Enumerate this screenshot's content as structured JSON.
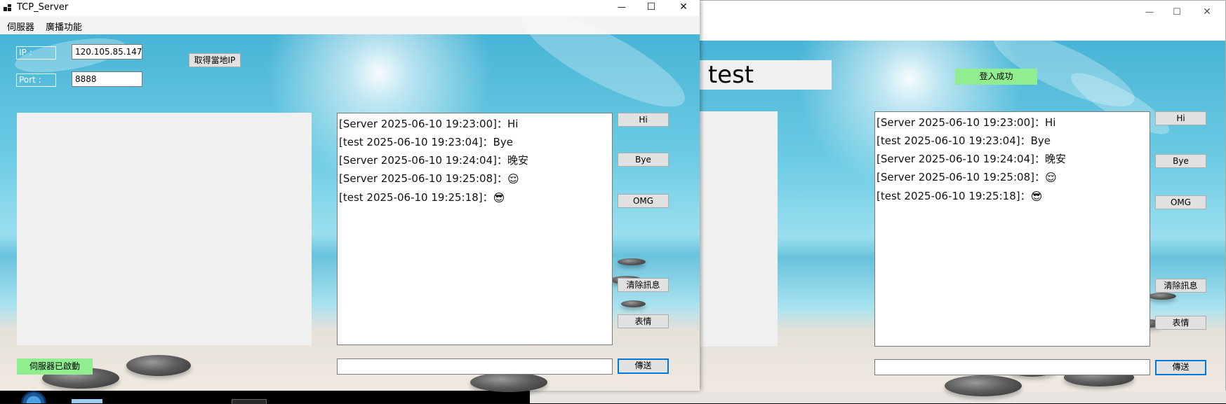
{
  "server_window": {
    "title": "TCP_Server",
    "minimize_glyph": "—",
    "maximize_glyph": "☐",
    "close_glyph": "✕",
    "menu": [
      "伺服器",
      "廣播功能"
    ],
    "ip_label": "IP :",
    "ip_value": "120.105.85.147",
    "port_label": "Port :",
    "port_value": "8888",
    "get_ip_button": "取得當地IP",
    "status": "伺服器已啟動",
    "buttons": {
      "hi": "Hi",
      "bye": "Bye",
      "omg": "OMG",
      "clear": "清除訊息",
      "emoji": "表情",
      "send": "傳送"
    },
    "messages": [
      {
        "text": "[Server 2025-06-10 19:23:00]：Hi",
        "emoji": ""
      },
      {
        "text": "[test 2025-06-10 19:23:04]：Bye",
        "emoji": ""
      },
      {
        "text": "[Server 2025-06-10 19:24:04]：晚安",
        "emoji": ""
      },
      {
        "text": "[Server 2025-06-10 19:25:08]：",
        "emoji": "😌"
      },
      {
        "text": "[test 2025-06-10 19:25:18]：",
        "emoji": "😎"
      }
    ],
    "input_value": ""
  },
  "client_window": {
    "minimize_glyph": "—",
    "maximize_glyph": "☐",
    "close_glyph": "✕",
    "user_name": "test",
    "status": "登入成功",
    "buttons": {
      "hi": "Hi",
      "bye": "Bye",
      "omg": "OMG",
      "clear": "清除訊息",
      "emoji": "表情",
      "send": "傳送"
    },
    "messages": [
      {
        "text": "[Server 2025-06-10 19:23:00]：Hi",
        "emoji": ""
      },
      {
        "text": "[test 2025-06-10 19:23:04]：Bye",
        "emoji": ""
      },
      {
        "text": "[Server 2025-06-10 19:24:04]：晚安",
        "emoji": ""
      },
      {
        "text": "[Server 2025-06-10 19:25:08]：",
        "emoji": "😌"
      },
      {
        "text": "[test 2025-06-10 19:25:18]：",
        "emoji": "😎"
      }
    ],
    "input_value": ""
  },
  "colors": {
    "status_green": "#90ee90",
    "send_border": "#0078d7"
  }
}
